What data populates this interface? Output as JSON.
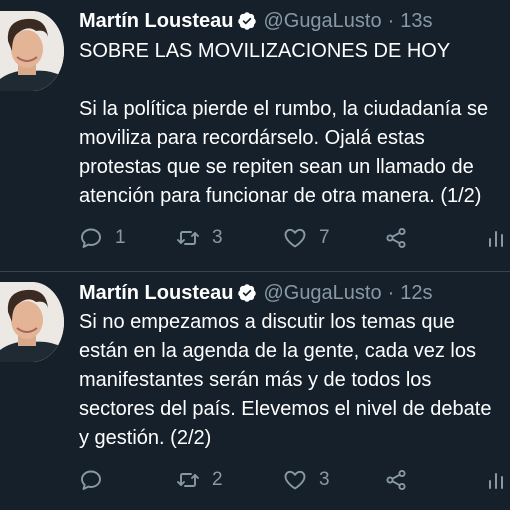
{
  "theme": {
    "background": "#15202b",
    "text": "#ffffff",
    "muted": "#8899a6",
    "accent": "#1da1f2"
  },
  "tweets": [
    {
      "author_name": "Martín Lousteau",
      "handle": "@GugaLusto",
      "separator": "·",
      "time": "13s",
      "text": "SOBRE LAS MOVILIZACIONES DE HOY\n\nSi la política pierde el rumbo, la ciudadanía se\nmoviliza para recordárselo. Ojalá estas\nprotestas que se repiten sean un llamado de\natención para funcionar de otra manera. (1/2)",
      "replies": "1",
      "retweets": "3",
      "likes": "7"
    },
    {
      "author_name": "Martín Lousteau",
      "handle": "@GugaLusto",
      "separator": "·",
      "time": "12s",
      "text": "Si no empezamos a discutir los temas que\nestán en la agenda de la gente, cada vez los\nmanifestantes serán más y de todos los\nsectores del país. Elevemos el nivel de debate\ny gestión. (2/2)",
      "replies": "",
      "retweets": "2",
      "likes": "3"
    }
  ]
}
